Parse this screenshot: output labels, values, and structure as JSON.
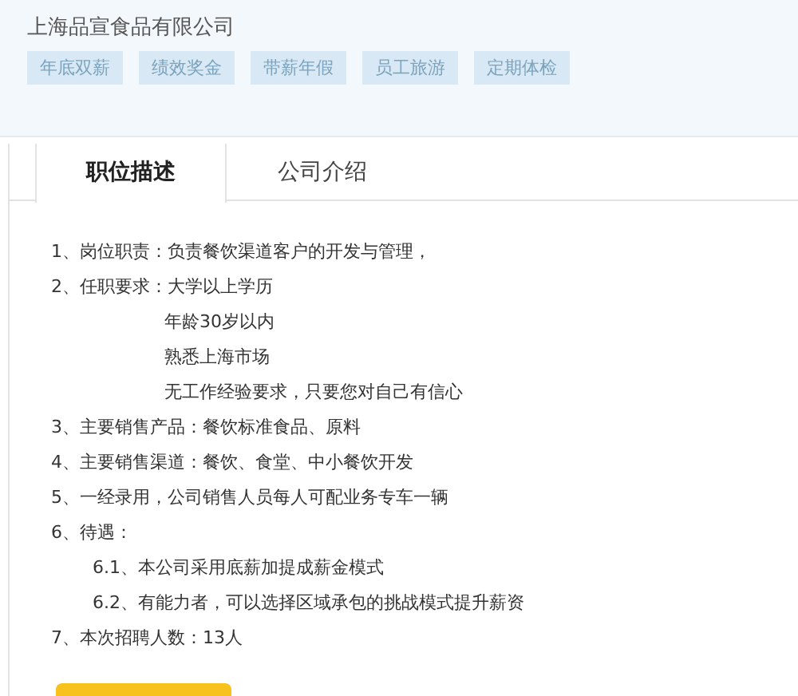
{
  "header": {
    "company": "上海品宣食品有限公司",
    "tags": [
      "年底双薪",
      "绩效奖金",
      "带薪年假",
      "员工旅游",
      "定期体检"
    ]
  },
  "tabs": [
    {
      "label": "职位描述",
      "selected": true
    },
    {
      "label": "公司介绍",
      "selected": false
    }
  ],
  "description": [
    {
      "kind": "item",
      "text": "1、岗位职责：负责餐饮渠道客户的开发与管理，"
    },
    {
      "kind": "item",
      "text": "2、任职要求：大学以上学历"
    },
    {
      "kind": "continuation",
      "text": "年龄30岁以内"
    },
    {
      "kind": "continuation",
      "text": "熟悉上海市场"
    },
    {
      "kind": "continuation",
      "text": "无工作经验要求，只要您对自己有信心"
    },
    {
      "kind": "item",
      "text": "3、主要销售产品：餐饮标准食品、原料"
    },
    {
      "kind": "item",
      "text": "4、主要销售渠道：餐饮、食堂、中小餐饮开发"
    },
    {
      "kind": "item",
      "text": "5、一经录用，公司销售人员每人可配业务专车一辆"
    },
    {
      "kind": "item",
      "text": "6、待遇："
    },
    {
      "kind": "sub",
      "text": "6.1、本公司采用底薪加提成薪金模式"
    },
    {
      "kind": "sub",
      "text": "6.2、有能力者，可以选择区域承包的挑战模式提升薪资"
    },
    {
      "kind": "item",
      "text": "7、本次招聘人数：13人"
    }
  ]
}
